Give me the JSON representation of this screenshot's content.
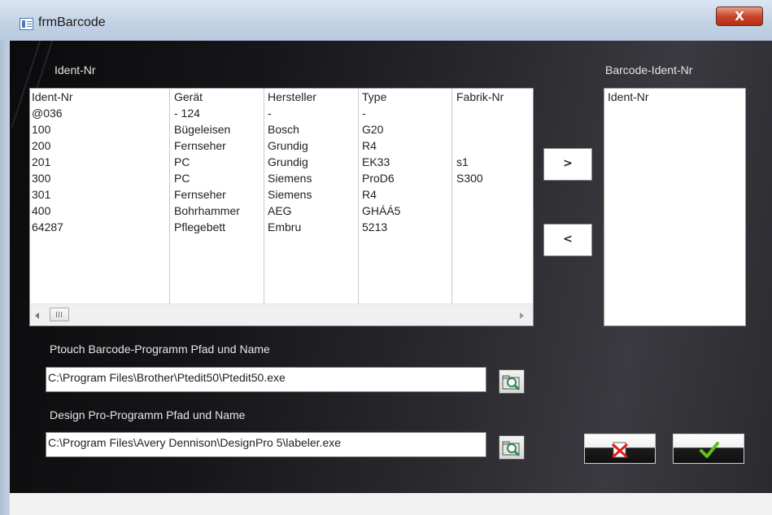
{
  "window": {
    "title": "frmBarcode",
    "close_glyph": "X"
  },
  "left_list": {
    "label": "Ident-Nr",
    "columns": [
      "Ident-Nr",
      "Gerät",
      "Hersteller",
      "Type",
      "Fabrik-Nr"
    ],
    "rows": [
      [
        "@036",
        "- 124",
        "-",
        "-",
        ""
      ],
      [
        "100",
        "Bügeleisen",
        "Bosch",
        "G20",
        ""
      ],
      [
        "200",
        "Fernseher",
        "Grundig",
        "R4",
        ""
      ],
      [
        "201",
        "PC",
        "Grundig",
        "EK33",
        "s1"
      ],
      [
        "300",
        "PC",
        "Siemens",
        "ProD6",
        "S300"
      ],
      [
        "301",
        "Fernseher",
        "Siemens",
        "R4",
        ""
      ],
      [
        "400",
        "Bohrhammer",
        "AEG",
        "GHÁÁ5",
        ""
      ],
      [
        "64287",
        "Pflegebett",
        "Embru",
        "5213",
        ""
      ]
    ]
  },
  "right_list": {
    "label": "Barcode-Ident-Nr",
    "column": "Ident-Nr"
  },
  "buttons": {
    "add": ">",
    "remove": "<"
  },
  "ptouch": {
    "label": "Ptouch Barcode-Programm Pfad und Name",
    "value": "C:\\Program Files\\Brother\\Ptedit50\\Ptedit50.exe"
  },
  "designpro": {
    "label": "Design Pro-Programm Pfad und Name",
    "value": "C:\\Program Files\\Avery Dennison\\DesignPro 5\\labeler.exe"
  },
  "icons": {
    "browse": "magnifier-folder-icon",
    "cancel": "red-x-icon",
    "ok": "green-check-icon",
    "window": "form-icon"
  },
  "colors": {
    "cancel_icon": "#e01b1b",
    "ok_icon": "#5cc21a",
    "browse_icon": "#2e8b57"
  }
}
